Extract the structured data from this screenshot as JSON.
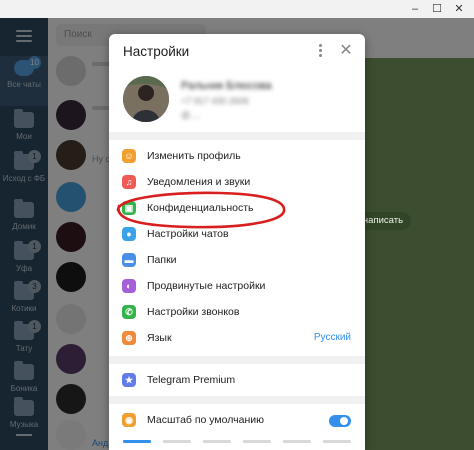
{
  "window": {
    "controls": [
      "–",
      "☐",
      "✕"
    ]
  },
  "folders": {
    "items": [
      {
        "label": "Все чаты",
        "badge": "10",
        "active": true
      },
      {
        "label": "Мои",
        "badge": ""
      },
      {
        "label": "Исход с ФБ",
        "badge": "1"
      },
      {
        "label": "Домик",
        "badge": ""
      },
      {
        "label": "Уфа",
        "badge": "1"
      },
      {
        "label": "Котики",
        "badge": "3"
      },
      {
        "label": "Тату",
        "badge": "1"
      },
      {
        "label": "Боника",
        "badge": ""
      },
      {
        "label": "Музыка",
        "badge": ""
      }
    ]
  },
  "chatlist": {
    "search_placeholder": "Поиск",
    "snippets": [
      "Ну с",
      "Анд"
    ]
  },
  "chatarea": {
    "hint": "бы написать"
  },
  "settings": {
    "title": "Настройки",
    "more_icon": "kebab-menu-icon",
    "close_icon": "✕",
    "profile": {
      "name": "Ральник Блюсова",
      "phone": "+7 917 430 2606",
      "username": "@...."
    },
    "items": [
      {
        "label": "Изменить профиль",
        "icon": "profile-icon",
        "glyph": "☺",
        "color": "#f0a030"
      },
      {
        "label": "Уведомления и звуки",
        "icon": "bell-icon",
        "glyph": "♫",
        "color": "#ef5b54"
      },
      {
        "label": "Конфиденциальность",
        "icon": "lock-icon",
        "glyph": "▣",
        "color": "#35b34b"
      },
      {
        "label": "Настройки чатов",
        "icon": "chat-bubble-icon",
        "glyph": "●",
        "color": "#3aa3e8"
      },
      {
        "label": "Папки",
        "icon": "folder-icon",
        "glyph": "▬",
        "color": "#4a8fe6"
      },
      {
        "label": "Продвинутые настройки",
        "icon": "advanced-icon",
        "glyph": "◐",
        "color": "#a55fd8"
      },
      {
        "label": "Настройки звонков",
        "icon": "phone-icon",
        "glyph": "✆",
        "color": "#35b34b"
      },
      {
        "label": "Язык",
        "icon": "globe-icon",
        "glyph": "⊕",
        "color": "#f28a3c",
        "value": "Русский"
      }
    ],
    "premium": {
      "label": "Telegram Premium",
      "icon": "star-icon",
      "glyph": "★",
      "color": "#5f7ce8"
    },
    "scale": {
      "label": "Масштаб по умолчанию",
      "icon": "eye-icon",
      "glyph": "◉",
      "color": "#f0a030",
      "enabled": true
    }
  }
}
